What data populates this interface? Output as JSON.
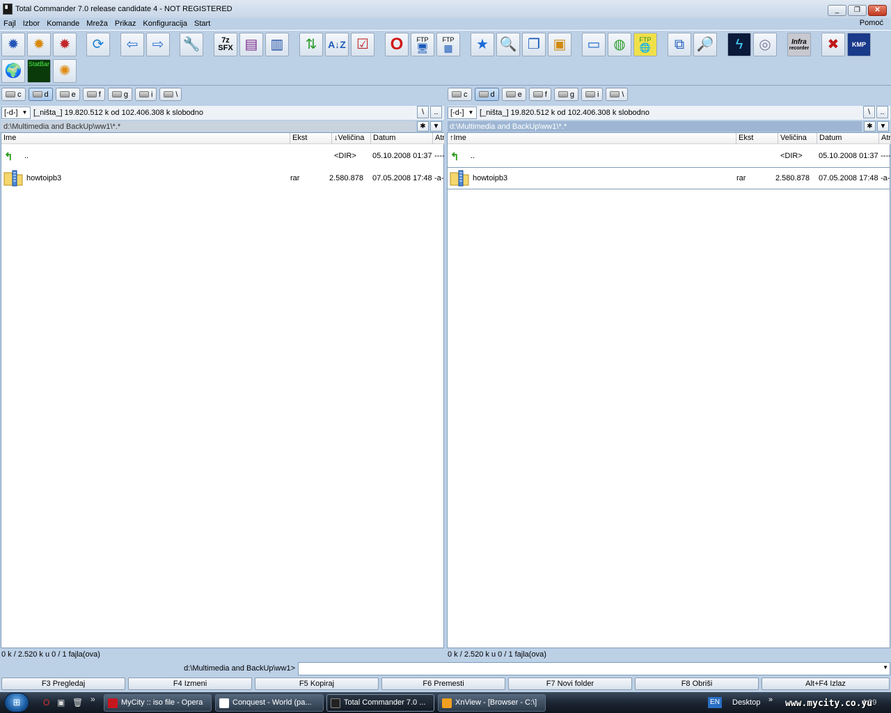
{
  "window": {
    "title": "Total Commander 7.0 release candidate 4 - NOT REGISTERED",
    "minimize": "_",
    "maximize": "❐",
    "close": "✕"
  },
  "menu": {
    "items": [
      "Fajl",
      "Izbor",
      "Komande",
      "Mreža",
      "Prikaz",
      "Konfiguracija",
      "Start"
    ],
    "help": "Pomoć"
  },
  "toolbar": {
    "sfx_label_top": "7z",
    "sfx_label_bottom": "SFX",
    "statbar_label": "StatBar",
    "infra_label": "Infra",
    "infra_sub": "recorder",
    "kmp_label": "KMP",
    "ftp_label": "FTP"
  },
  "drives": [
    "c",
    "d",
    "e",
    "f",
    "g",
    "i",
    "\\"
  ],
  "left_panel": {
    "drive_select": "[-d-]",
    "free_space": "[_ništa_]  19.820.512 k od 102.406.308 k slobodno",
    "root_btn": "\\",
    "up_btn": "..",
    "path": "d:\\Multimedia and BackUp\\ww1\\*.*",
    "columns": {
      "name": "Ime",
      "ext": "Ekst",
      "size": "↓Veličina",
      "date": "Datum",
      "attr": "Atr"
    },
    "rows": [
      {
        "name": "..",
        "ext": "",
        "size": "<DIR>",
        "date": "05.10.2008 01:37",
        "attr": "----"
      },
      {
        "name": "howtoipb3",
        "ext": "rar",
        "size": "2.580.878",
        "date": "07.05.2008 17:48",
        "attr": "-a-"
      }
    ],
    "status": "0 k / 2.520 k u 0 / 1 fajla(ova)"
  },
  "right_panel": {
    "drive_select": "[-d-]",
    "free_space": "[_ništa_]  19.820.512 k od 102.406.308 k slobodno",
    "root_btn": "\\",
    "up_btn": "..",
    "path": "d:\\Multimedia and BackUp\\ww1\\*.*",
    "columns": {
      "name": "↑Ime",
      "ext": "Ekst",
      "size": "Veličina",
      "date": "Datum",
      "attr": "Atr"
    },
    "rows": [
      {
        "name": "..",
        "ext": "",
        "size": "<DIR>",
        "date": "05.10.2008 01:37",
        "attr": "----"
      },
      {
        "name": "howtoipb3",
        "ext": "rar",
        "size": "2.580.878",
        "date": "07.05.2008 17:48",
        "attr": "-a-"
      }
    ],
    "status": "0 k / 2.520 k u 0 / 1 fajla(ova)"
  },
  "command_line": {
    "path": "d:\\Multimedia and BackUp\\ww1>",
    "value": ""
  },
  "fkeys": [
    "F3 Pregledaj",
    "F4 Izmeni",
    "F5 Kopiraj",
    "F6 Premesti",
    "F7 Novi folder",
    "F8 Obriši",
    "Alt+F4 Izlaz"
  ],
  "taskbar": {
    "tasks": [
      {
        "label": "MyCity :: iso file - Opera",
        "icon_color": "#c8161e"
      },
      {
        "label": "Conquest - World (pa...",
        "icon_color": "#ffffff"
      },
      {
        "label": "Total Commander 7.0 ...",
        "icon_color": "#222222"
      },
      {
        "label": "XnView - [Browser - C:\\]",
        "icon_color": "#f0a020"
      }
    ],
    "lang": "EN",
    "desktop": "Desktop",
    "overflow": "»",
    "clock": "4:39",
    "watermark": "www.mycity.co.yu"
  },
  "colors": {
    "accent": "#9eb6d3",
    "window_bg": "#bcd0e6",
    "taskbar": "#1c2633"
  }
}
